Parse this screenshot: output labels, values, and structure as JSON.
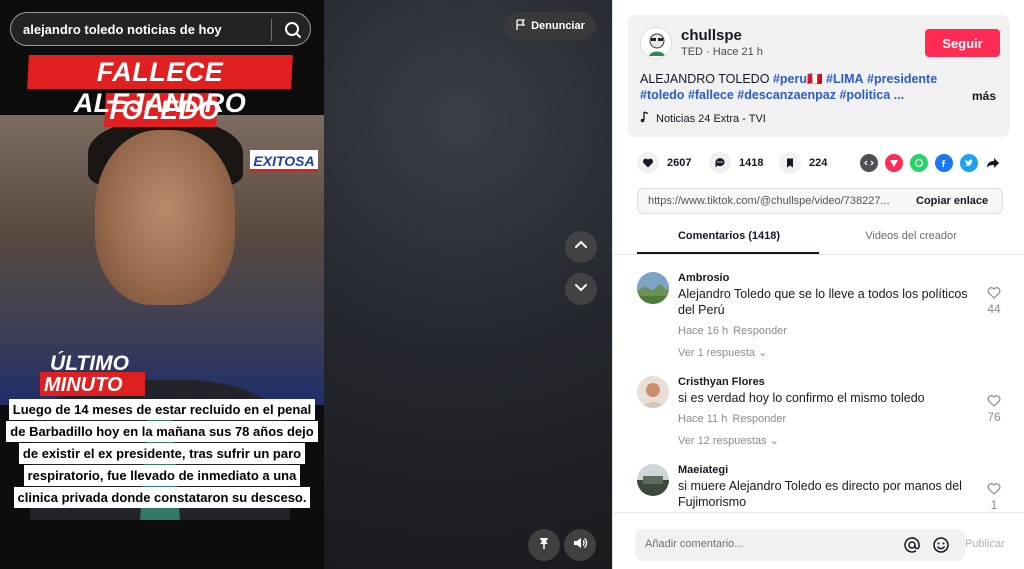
{
  "video": {
    "search_text": "alejandro toledo noticias de hoy",
    "report_label": "Denunciar",
    "headline_line1": "FALLECE ALEJANDRO",
    "headline_line2": "TOLEDO",
    "channel_logo": "EXITOSA",
    "badge_line1": "ÚLTIMO",
    "badge_line2": "MINUTO",
    "caption_lines": [
      "Luego de 14 meses de estar recluido en el penal",
      "de Barbadillo hoy en la mañana  sus 78 años dejo",
      "de existir  el ex presidente, tras sufrir un paro",
      "respiratorio, fue llevado de inmediato a una",
      "clinica privada donde constataron su desceso."
    ],
    "icons": {
      "search": "search-icon",
      "report": "flag-icon",
      "up": "chevron-up-icon",
      "down": "chevron-down-icon",
      "float": "floating-player-icon",
      "volume": "volume-icon"
    }
  },
  "post": {
    "username": "chullspe",
    "subline": "TED · Hace 21 h",
    "follow_label": "Seguir",
    "desc_prefix": "ALEJANDRO TOLEDO ",
    "hashtags_line1": [
      "#peru🇵🇪",
      "#LIMA",
      "#presidente"
    ],
    "hashtags_line2": [
      "#toledo",
      "#fallece",
      "#descanzaenpaz",
      "#politica",
      "..."
    ],
    "more_label": "más",
    "music": "Noticias 24 Extra - TVI",
    "accent_color": "#fe2c55"
  },
  "stats": {
    "likes": "2607",
    "comments": "1418",
    "saves": "224"
  },
  "share_icons": [
    "embed-icon",
    "send-icon",
    "whatsapp-icon",
    "facebook-icon",
    "twitter-icon",
    "share-arrow-icon"
  ],
  "link": {
    "url": "https://www.tiktok.com/@chullspe/video/738227...",
    "copy_label": "Copiar enlace"
  },
  "tabs": {
    "comments": "Comentarios (1418)",
    "creator_videos": "Videos del creador"
  },
  "comments": [
    {
      "user": "Ambrosio",
      "text": "Alejandro Toledo que se lo lleve a todos los políticos del Perú",
      "time": "Hace 16 h",
      "reply_label": "Responder",
      "replies": "Ver 1 respuesta",
      "likes": "44"
    },
    {
      "user": "Cristhyan Flores",
      "text": "si es verdad hoy lo confirmo el mismo toledo",
      "time": "Hace 11 h",
      "reply_label": "Responder",
      "replies": "Ver 12 respuestas",
      "likes": "76"
    },
    {
      "user": "Maeiategi",
      "text": "si muere Alejandro Toledo es directo por manos del Fujimorismo",
      "likes": "1"
    }
  ],
  "composer": {
    "placeholder": "Añadir comentario...",
    "post_label": "Publicar"
  }
}
